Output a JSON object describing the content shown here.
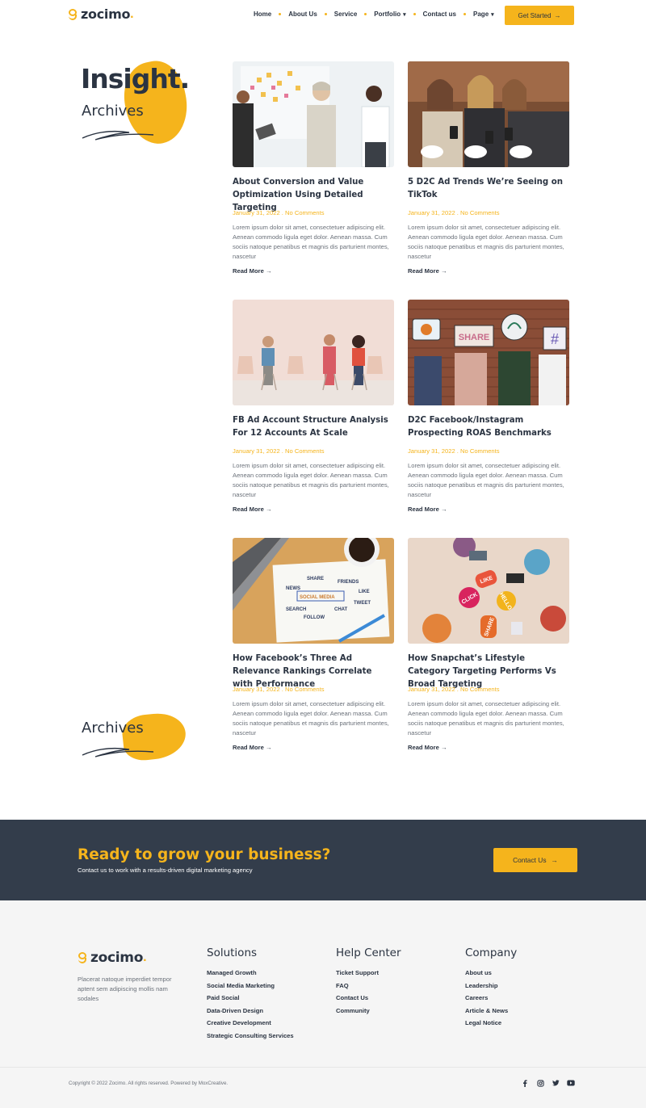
{
  "brand": {
    "name": "zocimo",
    "accent": "#f5b41c",
    "dark": "#333d4b"
  },
  "nav": {
    "items": [
      {
        "label": "Home"
      },
      {
        "label": "About Us"
      },
      {
        "label": "Service"
      },
      {
        "label": "Portfolio",
        "dropdown": true
      },
      {
        "label": "Contact us"
      },
      {
        "label": "Page",
        "dropdown": true
      }
    ],
    "cta_label": "Get Started"
  },
  "hero": {
    "title": "Insight.",
    "subtitle": "Archives",
    "bottom_label": "Archives"
  },
  "posts": [
    {
      "title": "About Conversion and Value Optimization Using Detailed Targeting",
      "meta": "January 31, 2022 . No Comments",
      "excerpt": "Lorem ipsum dolor sit amet, consectetuer adipiscing elit. Aenean commodo ligula eget dolor. Aenean massa. Cum sociis natoque penatibus et magnis dis parturient montes, nascetur",
      "read_more": "Read More",
      "image": "team-whiteboard-meeting"
    },
    {
      "title": "5 D2C Ad Trends We’re Seeing on TikTok",
      "meta": "January 31, 2022 . No Comments",
      "excerpt": "Lorem ipsum dolor sit amet, consectetuer adipiscing elit. Aenean commodo ligula eget dolor. Aenean massa. Cum sociis natoque penatibus et magnis dis parturient montes, nascetur",
      "read_more": "Read More",
      "image": "women-looking-at-phones"
    },
    {
      "title": "FB Ad Account Structure Analysis For 12 Accounts At Scale",
      "meta": "January 31, 2022 . No Comments",
      "excerpt": "Lorem ipsum dolor sit amet, consectetuer adipiscing elit. Aenean commodo ligula eget dolor. Aenean massa. Cum sociis natoque penatibus et magnis dis parturient montes, nascetur",
      "read_more": "Read More",
      "image": "people-on-chairs"
    },
    {
      "title": "D2C Facebook/Instagram Prospecting ROAS Benchmarks",
      "meta": "January 31, 2022 . No Comments",
      "excerpt": "Lorem ipsum dolor sit amet, consectetuer adipiscing elit. Aenean commodo ligula eget dolor. Aenean massa. Cum sociis natoque penatibus et magnis dis parturient montes, nascetur",
      "read_more": "Read More",
      "image": "social-signs-brick-wall",
      "sign_labels": [
        "SHARE",
        "#"
      ]
    },
    {
      "title": "How Facebook’s Three Ad Relevance Rankings Correlate with Performance",
      "meta": "January 31, 2022 . No Comments",
      "excerpt": "Lorem ipsum dolor sit amet, consectetuer adipiscing elit. Aenean commodo ligula eget dolor. Aenean massa. Cum sociis natoque penatibus et magnis dis parturient montes, nascetur",
      "read_more": "Read More",
      "image": "social-media-sketch",
      "sketch_words": [
        "NEWS",
        "SHARE",
        "FRIENDS",
        "LIKE",
        "SOCIAL MEDIA",
        "TWEET",
        "SEARCH",
        "CHAT",
        "FOLLOW"
      ]
    },
    {
      "title": "How Snapchat’s Lifestyle Category Targeting Performs Vs Broad Targeting",
      "meta": "January 31, 2022 . No Comments",
      "excerpt": "Lorem ipsum dolor sit amet, consectetuer adipiscing elit. Aenean commodo ligula eget dolor. Aenean massa. Cum sociis natoque penatibus et magnis dis parturient montes, nascetur",
      "read_more": "Read More",
      "image": "social-bubbles-top-view",
      "bubble_labels": [
        "LIKE",
        "CLICK",
        "HELLO",
        "SHARE"
      ]
    }
  ],
  "cta": {
    "title": "Ready to grow your business?",
    "subtitle": "Contact us to work with a results-driven digital marketing agency",
    "button_label": "Contact Us"
  },
  "footer": {
    "about": "Placerat natoque imperdiet tempor aptent sem adipiscing mollis nam sodales",
    "columns": [
      {
        "heading": "Solutions",
        "links": [
          "Managed Growth",
          "Social Media Marketing",
          "Paid Social",
          "Data-Driven Design",
          "Creative Development",
          "Strategic Consulting Services"
        ]
      },
      {
        "heading": "Help Center",
        "links": [
          "Ticket Support",
          "FAQ",
          "Contact Us",
          "Community"
        ]
      },
      {
        "heading": "Company",
        "links": [
          "About us",
          "Leadership",
          "Careers",
          "Article & News",
          "Legal Notice"
        ]
      }
    ],
    "copyright": "Copyright © 2022 Zocimo. All rights reserved. Powered by MoxCreative.",
    "socials": [
      "facebook-icon",
      "instagram-icon",
      "twitter-icon",
      "youtube-icon"
    ]
  }
}
